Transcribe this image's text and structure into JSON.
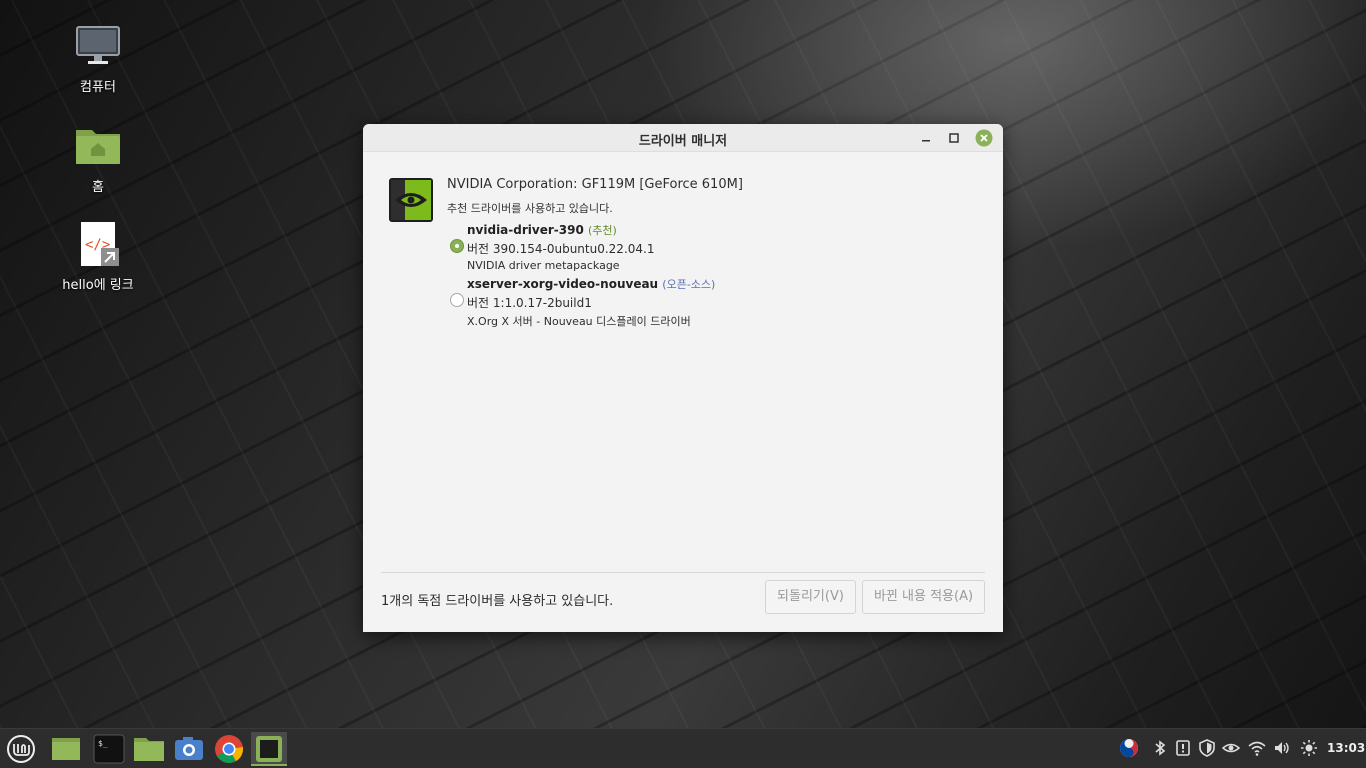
{
  "desktop": {
    "icons": [
      {
        "label": "컴퓨터",
        "icon": "computer-icon"
      },
      {
        "label": "홈",
        "icon": "home-folder-icon"
      },
      {
        "label": "hello에 링크",
        "icon": "html-file-link-icon"
      }
    ]
  },
  "window": {
    "title": "드라이버 매니저",
    "device": {
      "name": "NVIDIA Corporation: GF119M [GeForce 610M]",
      "status": "추천 드라이버를 사용하고 있습니다.",
      "icon": "nvidia-logo-icon"
    },
    "drivers": [
      {
        "name": "nvidia-driver-390",
        "tag": "(추천)",
        "version": "버전 390.154-0ubuntu0.22.04.1",
        "description": "NVIDIA driver metapackage",
        "selected": true
      },
      {
        "name": "xserver-xorg-video-nouveau",
        "tag": "(오픈-소스)",
        "version": "버전 1:1.0.17-2build1",
        "description": "X.Org X 서버 - Nouveau 디스플레이 드라이버",
        "selected": false
      }
    ],
    "footer_status": "1개의 독점 드라이버를 사용하고 있습니다.",
    "revert_label": "되돌리기(V)",
    "apply_label": "바뀐 내용 적용(A)"
  },
  "taskbar": {
    "apps": [
      "mint-menu-icon",
      "show-desktop-icon",
      "terminal-icon",
      "files-icon",
      "screenshot-icon",
      "chrome-icon",
      "driver-manager-icon"
    ],
    "tray": [
      "keyboard-input-icon",
      "bluetooth-icon",
      "update-manager-icon",
      "shield-icon",
      "nvidia-settings-icon",
      "wifi-icon",
      "volume-icon",
      "brightness-icon"
    ],
    "clock": "13:03"
  },
  "colors": {
    "accent": "#8bb158",
    "recommended": "#62882d",
    "open_source": "#5a6fb5",
    "close_button": "#8bb158"
  }
}
